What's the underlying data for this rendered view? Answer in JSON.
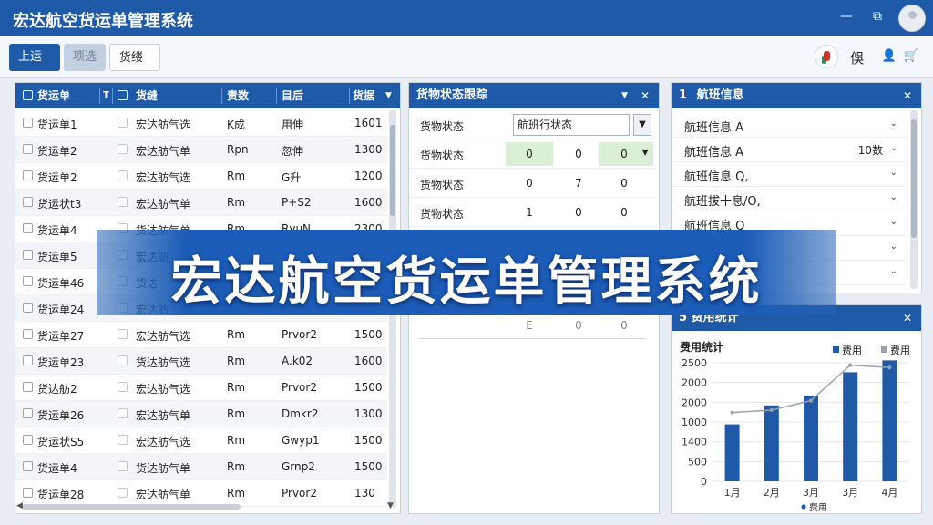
{
  "app": {
    "title": "宏达航空货运单管理系统",
    "banner": "宏达航空货运单管理系统",
    "user_name": "俁"
  },
  "colors": {
    "primary": "#1e5aa8",
    "bar": "#1e5aa8",
    "line": "#9aa3ad",
    "highlight_cell": "#dbefd6"
  },
  "icons": {
    "minimize": "minimize-icon",
    "restore": "restore-icon",
    "avatar": "user-avatar-icon",
    "user_badge": "user-badge-icon",
    "person": "person-icon",
    "cart": "cart-icon"
  },
  "toolbar": {
    "upload": "上运",
    "filter": "项选",
    "status": "货缕"
  },
  "waybill": {
    "columns": [
      "货运单",
      "T",
      "",
      "货缝",
      "责数",
      "目后",
      "货据"
    ],
    "rows": [
      {
        "id": "货运单1",
        "route": "宏达舫气选",
        "unit": "K成",
        "name": "用伸",
        "qty": "1601"
      },
      {
        "id": "货运单2",
        "route": "宏达舫气单",
        "unit": "Rpn",
        "name": "忽伸",
        "qty": "1300"
      },
      {
        "id": "货运单2",
        "route": "宏达舫气选",
        "unit": "Rm",
        "name": "G升",
        "qty": "1200"
      },
      {
        "id": "货运状t3",
        "route": "宏达舫气单",
        "unit": "Rm",
        "name": "P+S2",
        "qty": "1600"
      },
      {
        "id": "货运单4",
        "route": "货达舫气单",
        "unit": "Rm",
        "name": "RvuN",
        "qty": "2300"
      },
      {
        "id": "货运单5",
        "route": "宏达舫",
        "unit": "",
        "name": "",
        "qty": ""
      },
      {
        "id": "货运单46",
        "route": "货达",
        "unit": "",
        "name": "",
        "qty": ""
      },
      {
        "id": "货运单24",
        "route": "宏达舫",
        "unit": "",
        "name": "",
        "qty": ""
      },
      {
        "id": "货运单27",
        "route": "宏达舫气选",
        "unit": "Rm",
        "name": "Prvor2",
        "qty": "1500"
      },
      {
        "id": "货运单23",
        "route": "货达舫气选",
        "unit": "Rm",
        "name": "A.k02",
        "qty": "1600"
      },
      {
        "id": "货达舫2",
        "route": "宏达舫气选",
        "unit": "Rm",
        "name": "Prvor2",
        "qty": "1500"
      },
      {
        "id": "货运单26",
        "route": "宏达舫气单",
        "unit": "Rm",
        "name": "Dmkr2",
        "qty": "1300"
      },
      {
        "id": "货运状S5",
        "route": "宏达舫气选",
        "unit": "Rm",
        "name": "Gwyp1",
        "qty": "1500"
      },
      {
        "id": "货运单4",
        "route": "货达舫气单",
        "unit": "Rm",
        "name": "Grnp2",
        "qty": "1500"
      },
      {
        "id": "货运单28",
        "route": "宏达舫气单",
        "unit": "Rm",
        "name": "Prvor2",
        "qty": "130"
      }
    ]
  },
  "cargo": {
    "title": "货物状态跟踪",
    "select_label": "货物状态",
    "select_value": "航班行状态",
    "rows": [
      {
        "label": "货物状态",
        "values": [
          "0",
          "0",
          "0"
        ]
      },
      {
        "label": "货物状态",
        "values": [
          "0",
          "7",
          "0"
        ]
      },
      {
        "label": "货物状态",
        "values": [
          "1",
          "0",
          "0"
        ]
      }
    ],
    "extra_row": [
      "E",
      "0",
      "0"
    ]
  },
  "flight": {
    "title": "航班信息",
    "icon": "1",
    "items": [
      {
        "label": "航班信息 A",
        "extra": ""
      },
      {
        "label": "航班信息 A",
        "extra": "10数"
      },
      {
        "label": "航班信息 Q,",
        "extra": ""
      },
      {
        "label": "航班拔十息/O,",
        "extra": ""
      },
      {
        "label": "航班信息 Q",
        "extra": ""
      },
      {
        "label": "",
        "extra": ""
      },
      {
        "label": "",
        "extra": ""
      }
    ]
  },
  "fees": {
    "title": "5 费用统计",
    "chart_title": "费用统计",
    "legend": [
      "费用",
      "费用"
    ],
    "xlegend": "费用"
  },
  "chart_data": {
    "type": "bar",
    "title": "费用统计",
    "categories": [
      "1月",
      "2月",
      "3月",
      "3月",
      "4月"
    ],
    "series": [
      {
        "name": "费用",
        "type": "bar",
        "values": [
          1200,
          1600,
          1800,
          2300,
          2550
        ]
      },
      {
        "name": "费用",
        "type": "line",
        "values": [
          1450,
          1500,
          1700,
          2450,
          2400
        ]
      }
    ],
    "yticks": [
      "0",
      "500",
      "1400",
      "1000",
      "2000",
      "2000",
      "2500"
    ],
    "ylim": [
      0,
      2500
    ],
    "grid": true,
    "legend_position": "top-right"
  }
}
